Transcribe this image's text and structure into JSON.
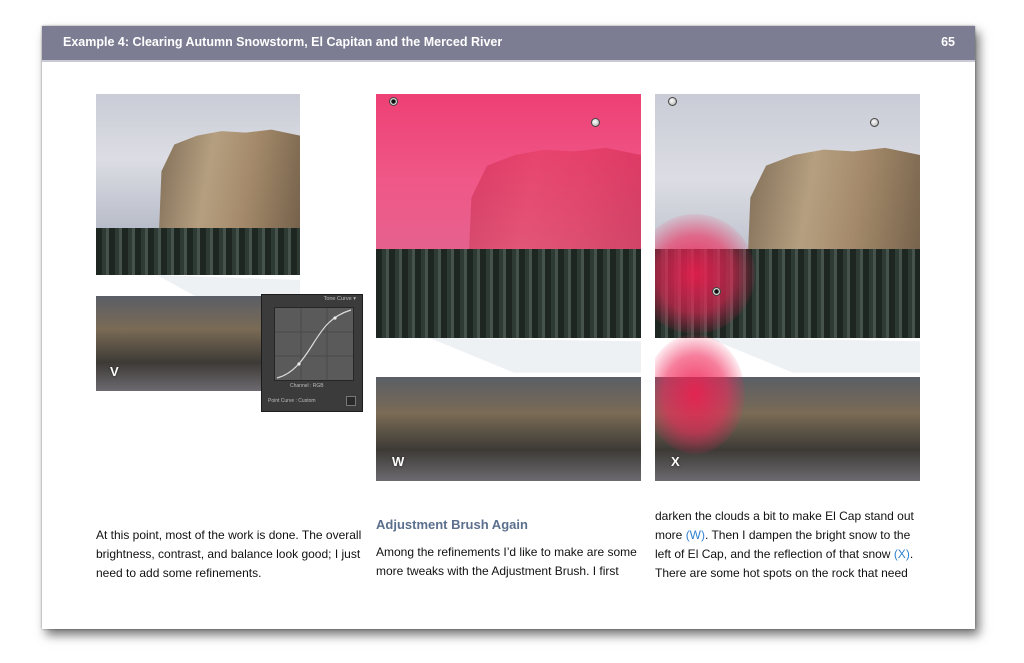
{
  "header": {
    "title": "Example 4: Clearing Autumn Snowstorm, El Capitan and the Merced River",
    "page_number": "65"
  },
  "figures": [
    {
      "label": "V"
    },
    {
      "label": "W"
    },
    {
      "label": "X"
    }
  ],
  "tone_curve": {
    "title": "Tone Curve",
    "channel_label": "Channel :",
    "channel_value": "RGB",
    "point_curve_label": "Point Curve :",
    "point_curve_value": "Custom"
  },
  "columns": {
    "left": {
      "text": [
        "At this point, most of the work is done. The overall",
        "brightness, contrast, and balance look good; I just",
        "need to add some refinements."
      ]
    },
    "middle": {
      "heading": "Adjustment Brush Again",
      "text": [
        "Among the refinements I’d like to make are some",
        "more tweaks with the Adjustment Brush. I first"
      ]
    },
    "right": {
      "line1": "darken the clouds a bit to make El Cap stand out",
      "line2_pre": "more ",
      "line2_ref": "(W)",
      "line2_post": ". Then I dampen the bright snow to the",
      "line3_pre": "left of El Cap, and the reflection of that snow ",
      "line3_ref": "(X)",
      "line3_post": ".",
      "line4": "There are some hot spots on the rock that need"
    }
  },
  "colors": {
    "header_bg": "#7c7d93",
    "heading": "#5b6f8e",
    "reference": "#2f82d0",
    "mask": "#f52864"
  }
}
